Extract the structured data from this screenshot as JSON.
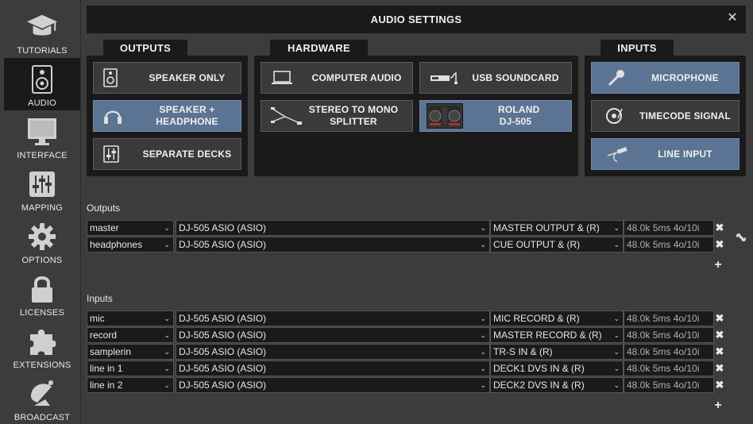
{
  "window": {
    "title": "AUDIO SETTINGS"
  },
  "sidebar": {
    "items": [
      {
        "label": "TUTORIALS",
        "icon": "mortarboard-icon"
      },
      {
        "label": "AUDIO",
        "icon": "speaker-icon",
        "active": true
      },
      {
        "label": "INTERFACE",
        "icon": "monitor-icon"
      },
      {
        "label": "MAPPING",
        "icon": "sliders-icon"
      },
      {
        "label": "OPTIONS",
        "icon": "gear-icon"
      },
      {
        "label": "LICENSES",
        "icon": "lock-icon"
      },
      {
        "label": "EXTENSIONS",
        "icon": "puzzle-icon"
      },
      {
        "label": "BROADCAST",
        "icon": "satellite-dish-icon"
      }
    ]
  },
  "sections": {
    "outputs": {
      "label": "OUTPUTS",
      "buttons": [
        {
          "label": "SPEAKER ONLY",
          "selected": false
        },
        {
          "label": "SPEAKER + HEADPHONE",
          "selected": true
        },
        {
          "label": "SEPARATE DECKS",
          "selected": false
        }
      ]
    },
    "hardware": {
      "label": "HARDWARE",
      "buttons": [
        {
          "label": "COMPUTER AUDIO",
          "selected": false
        },
        {
          "label": "USB SOUNDCARD",
          "selected": false
        },
        {
          "label": "STEREO TO MONO SPLITTER",
          "selected": false
        },
        {
          "label": "ROLAND DJ-505",
          "selected": true
        }
      ]
    },
    "inputs": {
      "label": "INPUTS",
      "buttons": [
        {
          "label": "MICROPHONE",
          "selected": true
        },
        {
          "label": "TIMECODE SIGNAL",
          "selected": false
        },
        {
          "label": "LINE INPUT",
          "selected": true
        }
      ]
    }
  },
  "outputs_table": {
    "label": "Outputs",
    "rows": [
      {
        "name": "master",
        "device": "DJ-505 ASIO (ASIO)",
        "channel": "MASTER OUTPUT & (R)",
        "info": "48.0k 5ms 4o/10i"
      },
      {
        "name": "headphones",
        "device": "DJ-505 ASIO (ASIO)",
        "channel": "CUE OUTPUT & (R)",
        "info": "48.0k 5ms 4o/10i"
      }
    ]
  },
  "inputs_table": {
    "label": "Inputs",
    "rows": [
      {
        "name": "mic",
        "device": "DJ-505 ASIO (ASIO)",
        "channel": "MIC RECORD & (R)",
        "info": "48.0k 5ms 4o/10i"
      },
      {
        "name": "record",
        "device": "DJ-505 ASIO (ASIO)",
        "channel": "MASTER RECORD & (R)",
        "info": "48.0k 5ms 4o/10i"
      },
      {
        "name": "samplerin",
        "device": "DJ-505 ASIO (ASIO)",
        "channel": "TR-S IN & (R)",
        "info": "48.0k 5ms 4o/10i"
      },
      {
        "name": "line in 1",
        "device": "DJ-505 ASIO (ASIO)",
        "channel": "DECK1 DVS IN & (R)",
        "info": "48.0k 5ms 4o/10i"
      },
      {
        "name": "line in 2",
        "device": "DJ-505 ASIO (ASIO)",
        "channel": "DECK2 DVS IN & (R)",
        "info": "48.0k 5ms 4o/10i"
      }
    ]
  },
  "glyphs": {
    "close": "✕",
    "remove": "✖",
    "add": "+",
    "chevron": "⌄"
  },
  "colors": {
    "selected": "#5c7493",
    "panel": "#1a1a1a",
    "background": "#3c3c3c"
  }
}
